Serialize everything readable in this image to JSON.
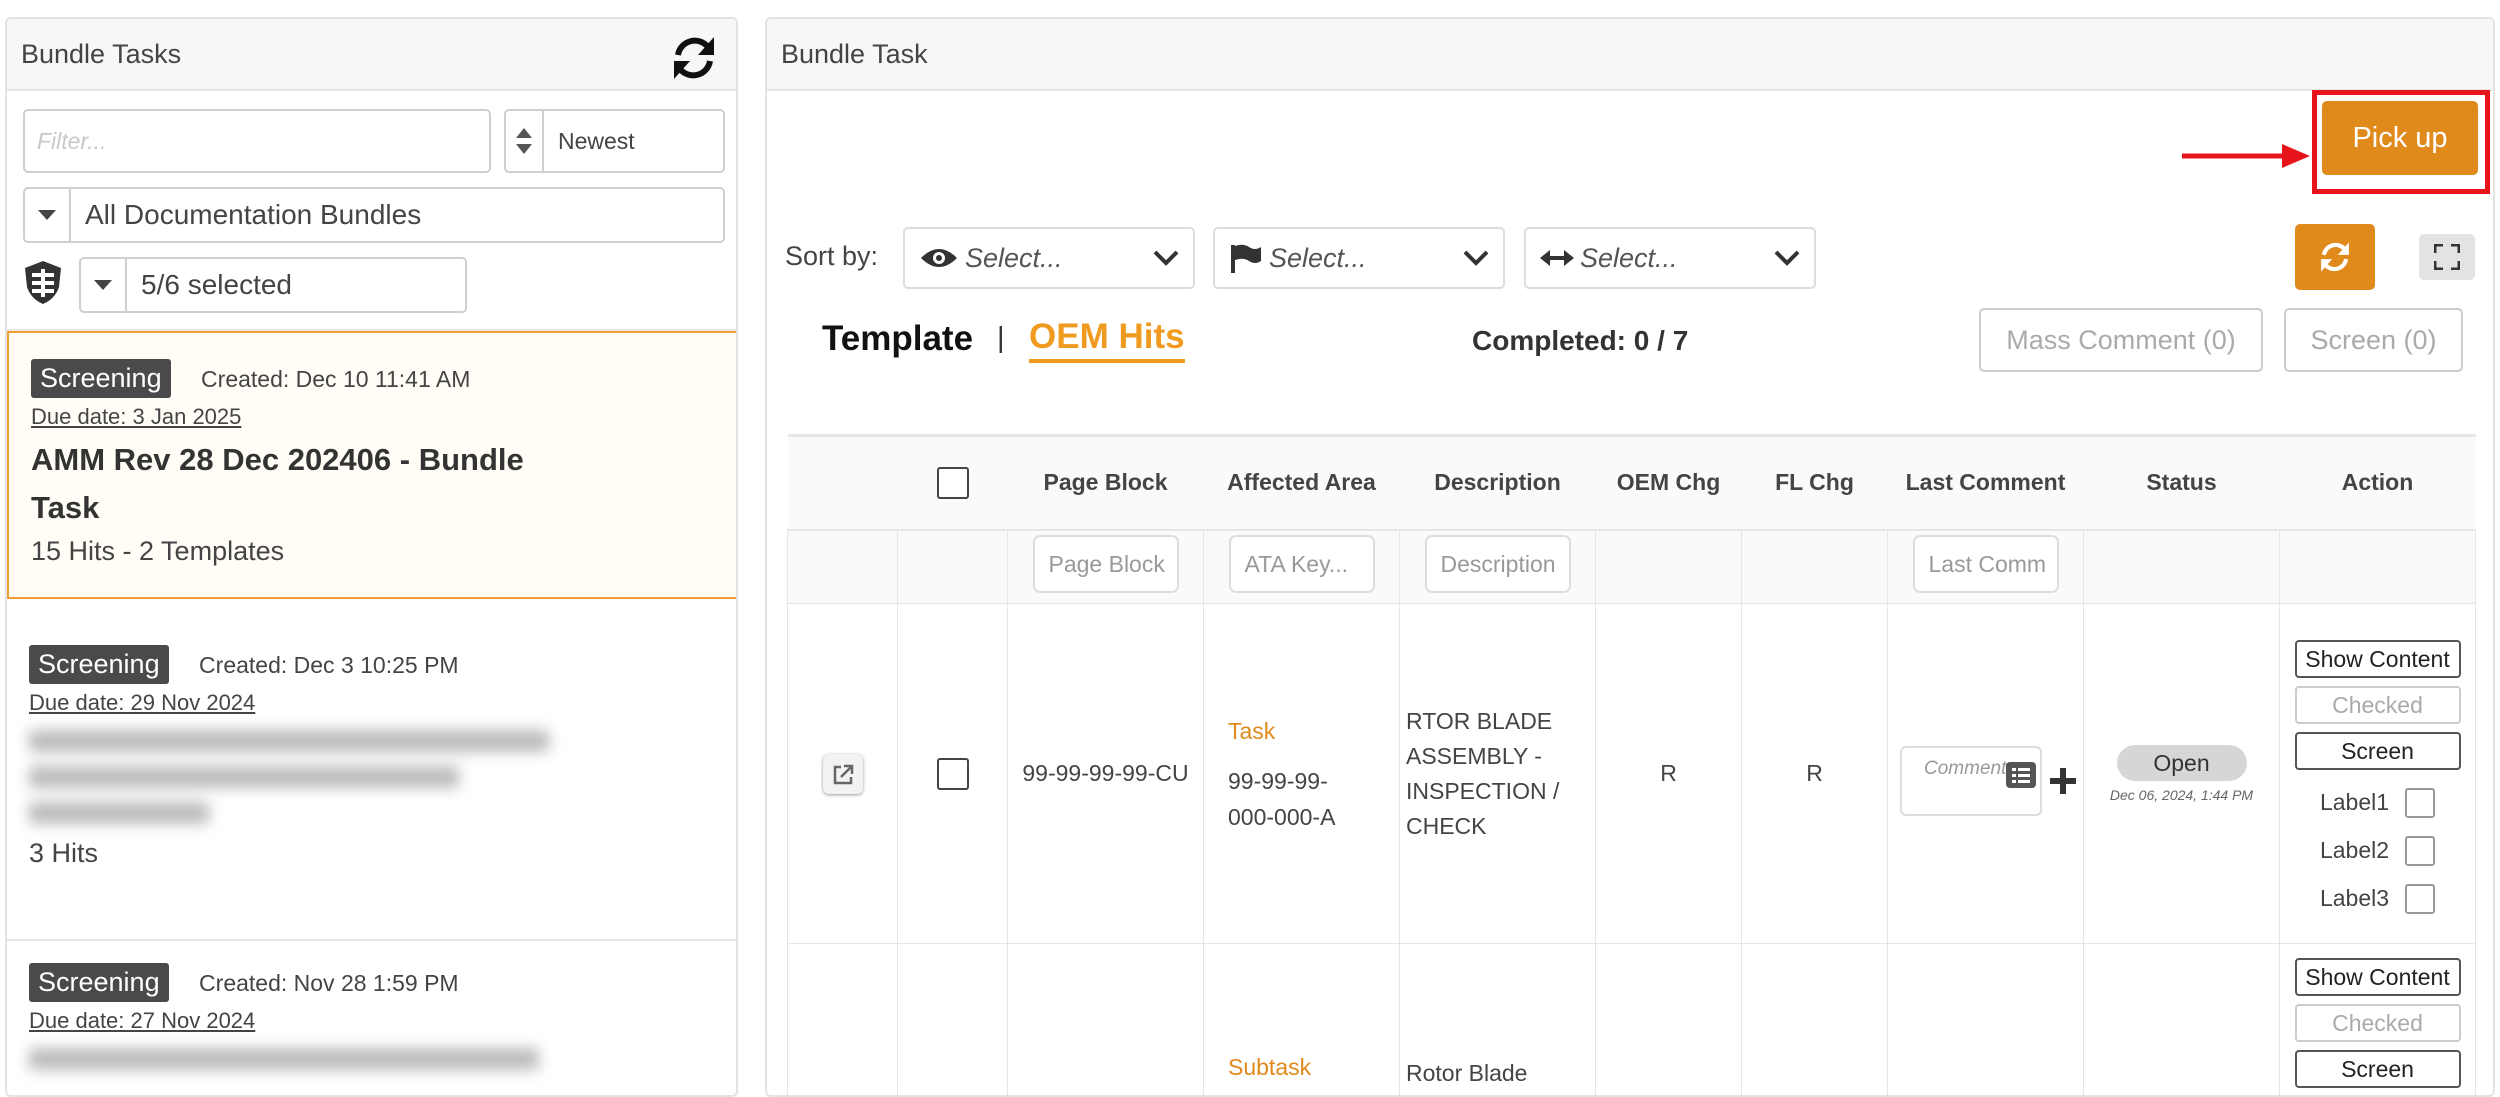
{
  "left_panel": {
    "title": "Bundle Tasks",
    "filter_placeholder": "Filter...",
    "sort_value": "Newest",
    "bundle_filter": "All Documentation Bundles",
    "selection": "5/6 selected",
    "cards": [
      {
        "badge": "Screening",
        "created": "Created: Dec 10 11:41 AM",
        "due": "Due date: 3 Jan 2025",
        "title": "AMM Rev 28 Dec 202406 - Bundle Task",
        "hits": "15 Hits - 2 Templates"
      },
      {
        "badge": "Screening",
        "created": "Created: Dec 3 10:25 PM",
        "due": "Due date: 29 Nov 2024",
        "hits": "3 Hits"
      },
      {
        "badge": "Screening",
        "created": "Created: Nov 28 1:59 PM",
        "due": "Due date: 27 Nov 2024"
      }
    ]
  },
  "right_panel": {
    "title": "Bundle Task",
    "pickup_label": "Pick up",
    "sort_label": "Sort by:",
    "select_placeholder": "Select...",
    "tabs": {
      "template": "Template",
      "divider": "|",
      "oem": "OEM Hits"
    },
    "completed": "Completed: 0 / 7",
    "mass_comment": "Mass Comment (0)",
    "screen": "Screen (0)",
    "columns": [
      "Page Block",
      "Affected Area",
      "Description",
      "OEM Chg",
      "FL Chg",
      "Last Comment",
      "Status",
      "Action"
    ],
    "filters": {
      "page_block": "Page Block",
      "ata": "ATA Key...",
      "description": "Description",
      "last_comment": "Last Comm"
    },
    "rows": [
      {
        "page_block": "99-99-99-99-CU",
        "area_type": "Task",
        "area_code": "99-99-99-000-000-A",
        "description": "RTOR BLADE ASSEMBLY - INSPECTION / CHECK",
        "oem_chg": "R",
        "fl_chg": "R",
        "comment_placeholder": "Comment ..",
        "status": "Open",
        "status_date": "Dec 06, 2024, 1:44 PM",
        "actions": {
          "show": "Show Content",
          "checked": "Checked",
          "screen": "Screen"
        },
        "labels": [
          "Label1",
          "Label2",
          "Label3"
        ]
      },
      {
        "area_type": "Subtask",
        "description": "Rotor Blade",
        "actions": {
          "show": "Show Content",
          "checked": "Checked",
          "screen": "Screen"
        }
      }
    ]
  },
  "colors": {
    "accent": "#e08a1c",
    "highlight": "#e8141c",
    "badge": "#4a4a4a"
  }
}
